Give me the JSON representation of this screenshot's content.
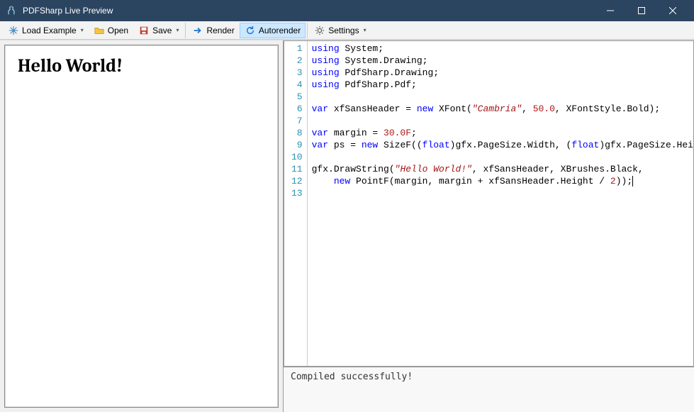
{
  "window": {
    "title": "PDFSharp Live Preview"
  },
  "toolbar": {
    "load_example": "Load Example",
    "open": "Open",
    "save": "Save",
    "render": "Render",
    "autorender": "Autorender",
    "settings": "Settings"
  },
  "preview": {
    "heading": "Hello World!"
  },
  "editor": {
    "lines": [
      {
        "n": 1,
        "tokens": [
          [
            "kw",
            "using"
          ],
          [
            "",
            " System;"
          ]
        ]
      },
      {
        "n": 2,
        "tokens": [
          [
            "kw",
            "using"
          ],
          [
            "",
            " System.Drawing;"
          ]
        ]
      },
      {
        "n": 3,
        "tokens": [
          [
            "kw",
            "using"
          ],
          [
            "",
            " PdfSharp.Drawing;"
          ]
        ]
      },
      {
        "n": 4,
        "tokens": [
          [
            "kw",
            "using"
          ],
          [
            "",
            " PdfSharp.Pdf;"
          ]
        ]
      },
      {
        "n": 5,
        "tokens": []
      },
      {
        "n": 6,
        "tokens": [
          [
            "kw",
            "var"
          ],
          [
            "",
            " xfSansHeader = "
          ],
          [
            "kw",
            "new"
          ],
          [
            "",
            " XFont("
          ],
          [
            "str",
            "\"Cambria\""
          ],
          [
            "",
            ", "
          ],
          [
            "num",
            "50.0"
          ],
          [
            "",
            ", XFontStyle.Bold);"
          ]
        ]
      },
      {
        "n": 7,
        "tokens": []
      },
      {
        "n": 8,
        "tokens": [
          [
            "kw",
            "var"
          ],
          [
            "",
            " margin = "
          ],
          [
            "num",
            "30.0F"
          ],
          [
            "",
            ";"
          ]
        ]
      },
      {
        "n": 9,
        "tokens": [
          [
            "kw",
            "var"
          ],
          [
            "",
            " ps = "
          ],
          [
            "kw",
            "new"
          ],
          [
            "",
            " SizeF(("
          ],
          [
            "kw",
            "float"
          ],
          [
            "",
            ")gfx.PageSize.Width, ("
          ],
          [
            "kw",
            "float"
          ],
          [
            "",
            ")gfx.PageSize.Height);"
          ]
        ]
      },
      {
        "n": 10,
        "tokens": []
      },
      {
        "n": 11,
        "tokens": [
          [
            "",
            "gfx.DrawString("
          ],
          [
            "str",
            "\"Hello World!\""
          ],
          [
            "",
            ", xfSansHeader, XBrushes.Black,"
          ]
        ]
      },
      {
        "n": 12,
        "tokens": [
          [
            "",
            "    "
          ],
          [
            "kw",
            "new"
          ],
          [
            "",
            " PointF(margin, margin + xfSansHeader.Height / "
          ],
          [
            "num",
            "2"
          ],
          [
            "",
            ")"
          ],
          [
            "",
            ");"
          ]
        ],
        "cursor": true
      },
      {
        "n": 13,
        "tokens": []
      }
    ]
  },
  "output": {
    "message": "Compiled successfully!"
  }
}
